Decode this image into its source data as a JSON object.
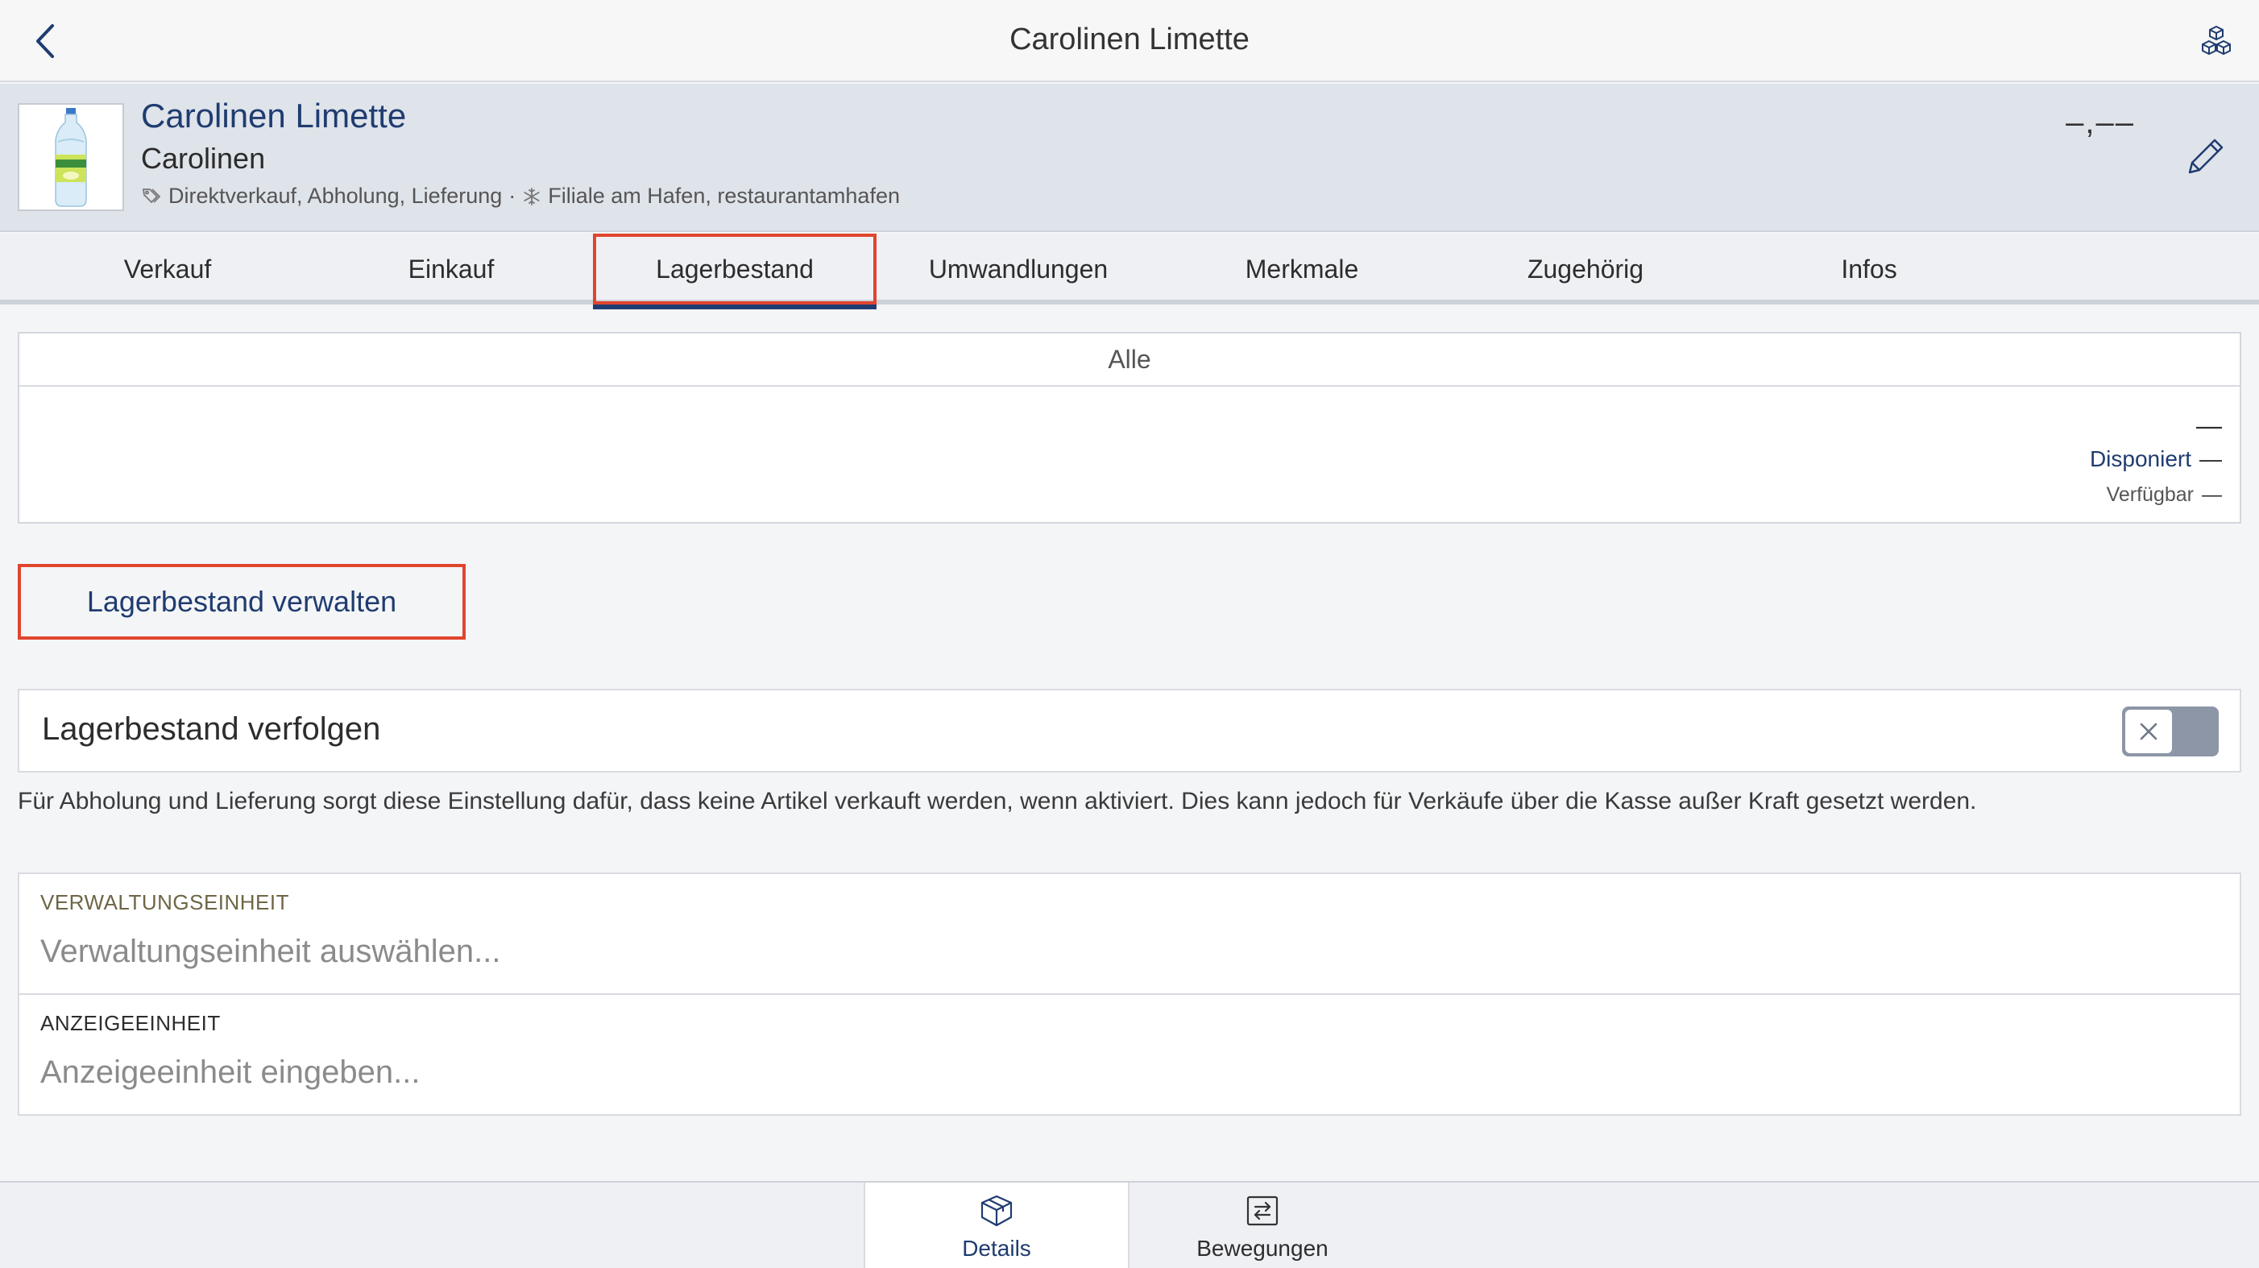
{
  "nav": {
    "title": "Carolinen Limette",
    "back_icon": "chevron-left-icon",
    "right_icon": "cubes-icon"
  },
  "product": {
    "name": "Carolinen Limette",
    "brand": "Carolinen",
    "channels": "Direktverkauf, Abholung, Lieferung",
    "separator": "·",
    "locations": "Filiale am Hafen, restaurantamhafen",
    "price": "–,––"
  },
  "tabs": [
    {
      "label": "Verkauf"
    },
    {
      "label": "Einkauf"
    },
    {
      "label": "Lagerbestand"
    },
    {
      "label": "Umwandlungen"
    },
    {
      "label": "Merkmale"
    },
    {
      "label": "Zugehörig"
    },
    {
      "label": "Infos"
    }
  ],
  "active_tab": "Lagerbestand",
  "stock": {
    "header": "Alle",
    "total": "—",
    "disponiert_label": "Disponiert",
    "disponiert_value": "—",
    "verfuegbar_label": "Verfügbar",
    "verfuegbar_value": "—"
  },
  "manage_button": "Lagerbestand verwalten",
  "tracking": {
    "label": "Lagerbestand verfolgen",
    "enabled": false,
    "description": "Für Abholung und Lieferung sorgt diese Einstellung dafür, dass keine Artikel verkauft werden, wenn aktiviert. Dies kann jedoch für Verkäufe über die Kasse außer Kraft gesetzt werden."
  },
  "fields": {
    "admin_unit": {
      "label": "VERWALTUNGSEINHEIT",
      "value": "",
      "placeholder": "Verwaltungseinheit auswählen..."
    },
    "display_unit": {
      "label": "ANZEIGEEINHEIT",
      "value": "",
      "placeholder": "Anzeigeeinheit eingeben..."
    }
  },
  "bottom_tabs": [
    {
      "label": "Details",
      "icon": "box-icon"
    },
    {
      "label": "Bewegungen",
      "icon": "transfer-icon"
    }
  ],
  "colors": {
    "accent": "#1f3c70",
    "highlight": "#e0452e",
    "header_bg": "#dfe3ea"
  }
}
